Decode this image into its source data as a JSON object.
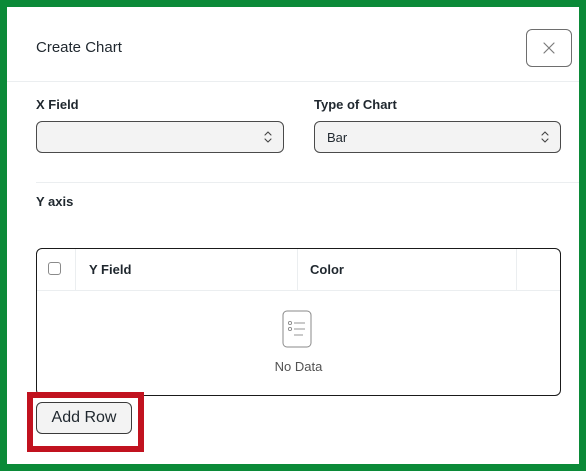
{
  "dialog": {
    "title": "Create Chart",
    "close_icon": "close-icon"
  },
  "form": {
    "x_field_label": "X Field",
    "x_field_value": "",
    "chart_type_label": "Type of Chart",
    "chart_type_value": "Bar",
    "y_axis_label": "Y axis"
  },
  "grid": {
    "columns": [
      "Y Field",
      "Color"
    ],
    "empty_icon": "list-icon",
    "empty_text": "No Data"
  },
  "actions": {
    "add_row_label": "Add Row"
  },
  "colors": {
    "frame_border": "#0b8a38",
    "highlight_border": "#c1121f"
  }
}
